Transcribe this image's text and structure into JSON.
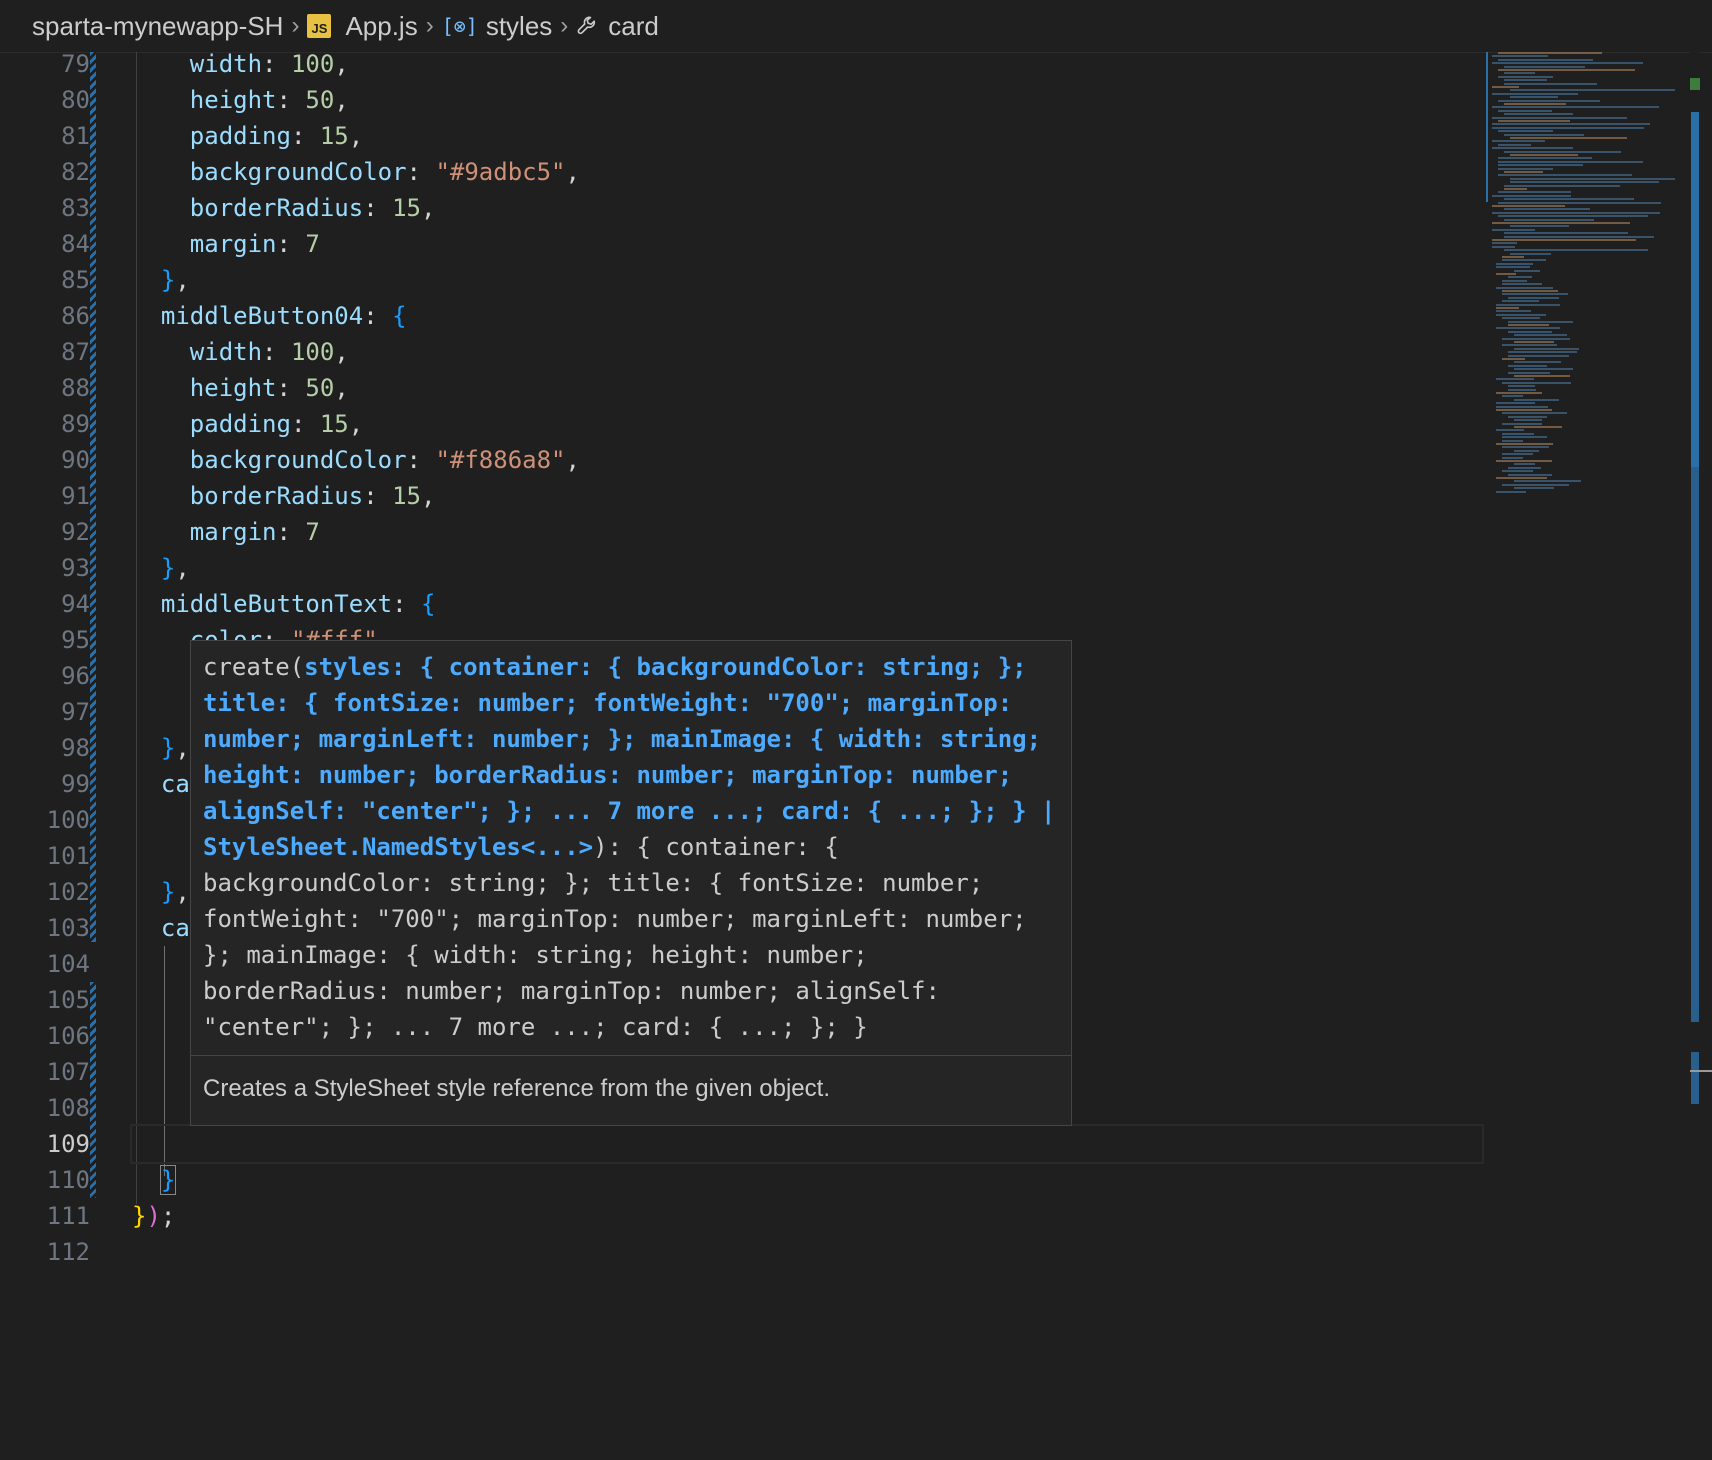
{
  "breadcrumb": {
    "folder": "sparta-mynewapp-SH",
    "file_badge": "JS",
    "file": "App.js",
    "symbol_icon": "[⊗]",
    "symbol": "styles",
    "leaf": "card",
    "sep": "›"
  },
  "editor": {
    "current_line": 109,
    "line_numbers": [
      "79",
      "80",
      "81",
      "82",
      "83",
      "84",
      "85",
      "86",
      "87",
      "88",
      "89",
      "90",
      "91",
      "92",
      "93",
      "94",
      "95",
      "96",
      "97",
      "98",
      "99",
      "100",
      "101",
      "102",
      "103",
      "104",
      "105",
      "106",
      "107",
      "108",
      "109",
      "110",
      "111",
      "112"
    ],
    "lines": {
      "l79": {
        "key": "width",
        "val": "100"
      },
      "l80": {
        "key": "height",
        "val": "50"
      },
      "l81": {
        "key": "padding",
        "val": "15"
      },
      "l82": {
        "key": "backgroundColor",
        "val": "\"#9adbc5\""
      },
      "l83": {
        "key": "borderRadius",
        "val": "15"
      },
      "l84": {
        "key": "margin",
        "val": "7"
      },
      "l86": {
        "key": "middleButton04"
      },
      "l87": {
        "key": "width",
        "val": "100"
      },
      "l88": {
        "key": "height",
        "val": "50"
      },
      "l89": {
        "key": "padding",
        "val": "15"
      },
      "l90": {
        "key": "backgroundColor",
        "val": "\"#f886a8\""
      },
      "l91": {
        "key": "borderRadius",
        "val": "15"
      },
      "l92": {
        "key": "margin",
        "val": "7"
      },
      "l94": {
        "key": "middleButtonText"
      },
      "l95": {
        "key": "color",
        "val": "\"#fff\""
      },
      "l99": {
        "key": "ca"
      },
      "l103": {
        "key": "ca"
      }
    }
  },
  "hover": {
    "sig_start": "create(",
    "sig_param": "styles: { container: { backgroundColor: string; }; title: { fontSize: number; fontWeight: \"700\"; marginTop: number; marginLeft: number; }; mainImage: { width: string; height: number; borderRadius: number; marginTop: number; alignSelf: \"center\"; }; ... 7 more ...; card: { ...; }; } | StyleSheet.NamedStyles<...>",
    "sig_rest": "): { container: { backgroundColor: string; }; title: { fontSize: number; fontWeight: \"700\"; marginTop: number; marginLeft: number; }; mainImage: { width: string; height: number; borderRadius: number; marginTop: number; alignSelf: \"center\"; }; ... 7 more ...; card: { ...; }; }",
    "doc": "Creates a StyleSheet style reference from the given object."
  },
  "colors": {
    "background": "#1f1f1f",
    "property": "#9cdcfe",
    "number": "#b5cea8",
    "string": "#ce9178",
    "bracket_blue": "#179fff",
    "bracket_pink": "#da70d6",
    "bracket_gold": "#ffd700",
    "hover_highlight": "#4daafc"
  }
}
